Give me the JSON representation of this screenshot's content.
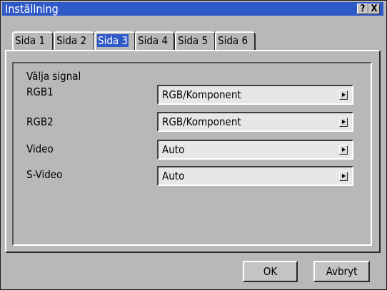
{
  "window": {
    "title": "Inställning",
    "help_glyph": "?",
    "close_glyph": "X"
  },
  "tabs": [
    {
      "label": "Sida 1",
      "active": false
    },
    {
      "label": "Sida 2",
      "active": false
    },
    {
      "label": "Sida 3",
      "active": true
    },
    {
      "label": "Sida 4",
      "active": false
    },
    {
      "label": "Sida 5",
      "active": false
    },
    {
      "label": "Sida 6",
      "active": false
    }
  ],
  "section": {
    "heading": "Välja signal",
    "rows": [
      {
        "label": "RGB1",
        "value": "RGB/Komponent"
      },
      {
        "label": "RGB2",
        "value": "RGB/Komponent"
      },
      {
        "label": "Video",
        "value": "Auto"
      },
      {
        "label": "S-Video",
        "value": "Auto"
      }
    ]
  },
  "buttons": {
    "ok": "OK",
    "cancel": "Avbryt"
  },
  "colors": {
    "titlebar": "#2f59c7",
    "face": "#b8b8b8",
    "field": "#e7e7e7"
  }
}
